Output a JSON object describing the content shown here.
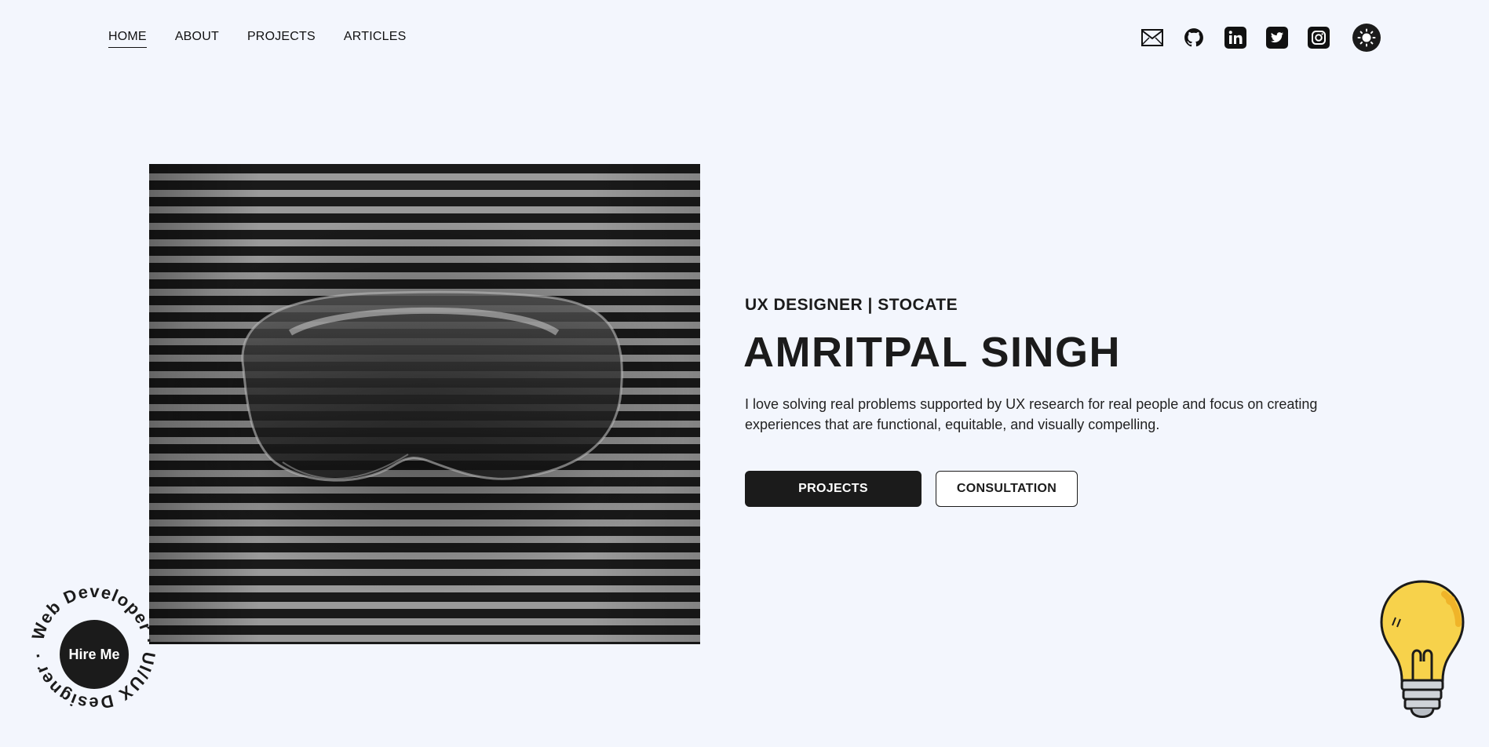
{
  "nav": {
    "items": [
      {
        "label": "HOME",
        "active": true
      },
      {
        "label": "ABOUT",
        "active": false
      },
      {
        "label": "PROJECTS",
        "active": false
      },
      {
        "label": "ARTICLES",
        "active": false
      }
    ]
  },
  "socials": {
    "icons": [
      "mail-icon",
      "github-icon",
      "linkedin-icon",
      "twitter-icon",
      "instagram-icon",
      "sun-icon"
    ]
  },
  "hero": {
    "subtitle": "UX DESIGNER | STOCATE",
    "name": "AMRITPAL SINGH",
    "bio": "I love solving real problems supported by UX research for real people and focus on creating experiences that are functional, equitable, and visually compelling.",
    "primary_button": "PROJECTS",
    "secondary_button": "CONSULTATION"
  },
  "badge": {
    "button_label": "Hire Me",
    "ring_text": "Web Developer · UI/UX Designer ·"
  },
  "colors": {
    "background": "#f3f6fd",
    "ink": "#1b1b1b",
    "bulb": "#f7d24b"
  }
}
